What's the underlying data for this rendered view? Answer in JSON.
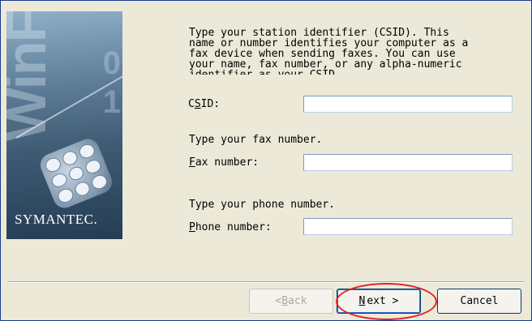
{
  "banner": {
    "watermark": "WinFax",
    "digits": "0\n1",
    "brand": "SYMANTEC."
  },
  "intro_text": "Type your station identifier (CSID). This\nname or number identifies your computer as a\nfax device when sending faxes. You can use\nyour name, fax number, or any alpha-numeric\nidentifier as your CSID.",
  "csid": {
    "label_pre": "C",
    "label_access": "S",
    "label_post": "ID:",
    "value": ""
  },
  "fax": {
    "prompt": "Type your fax number.",
    "label_access": "F",
    "label_post": "ax number:",
    "value": ""
  },
  "phone": {
    "prompt": "Type your phone number.",
    "label_access": "P",
    "label_post": "hone number:",
    "value": ""
  },
  "buttons": {
    "back_pre": "< ",
    "back_access": "B",
    "back_post": "ack",
    "next_access": "N",
    "next_post": "ext >",
    "cancel": "Cancel"
  },
  "annotation_color": "#e02020"
}
